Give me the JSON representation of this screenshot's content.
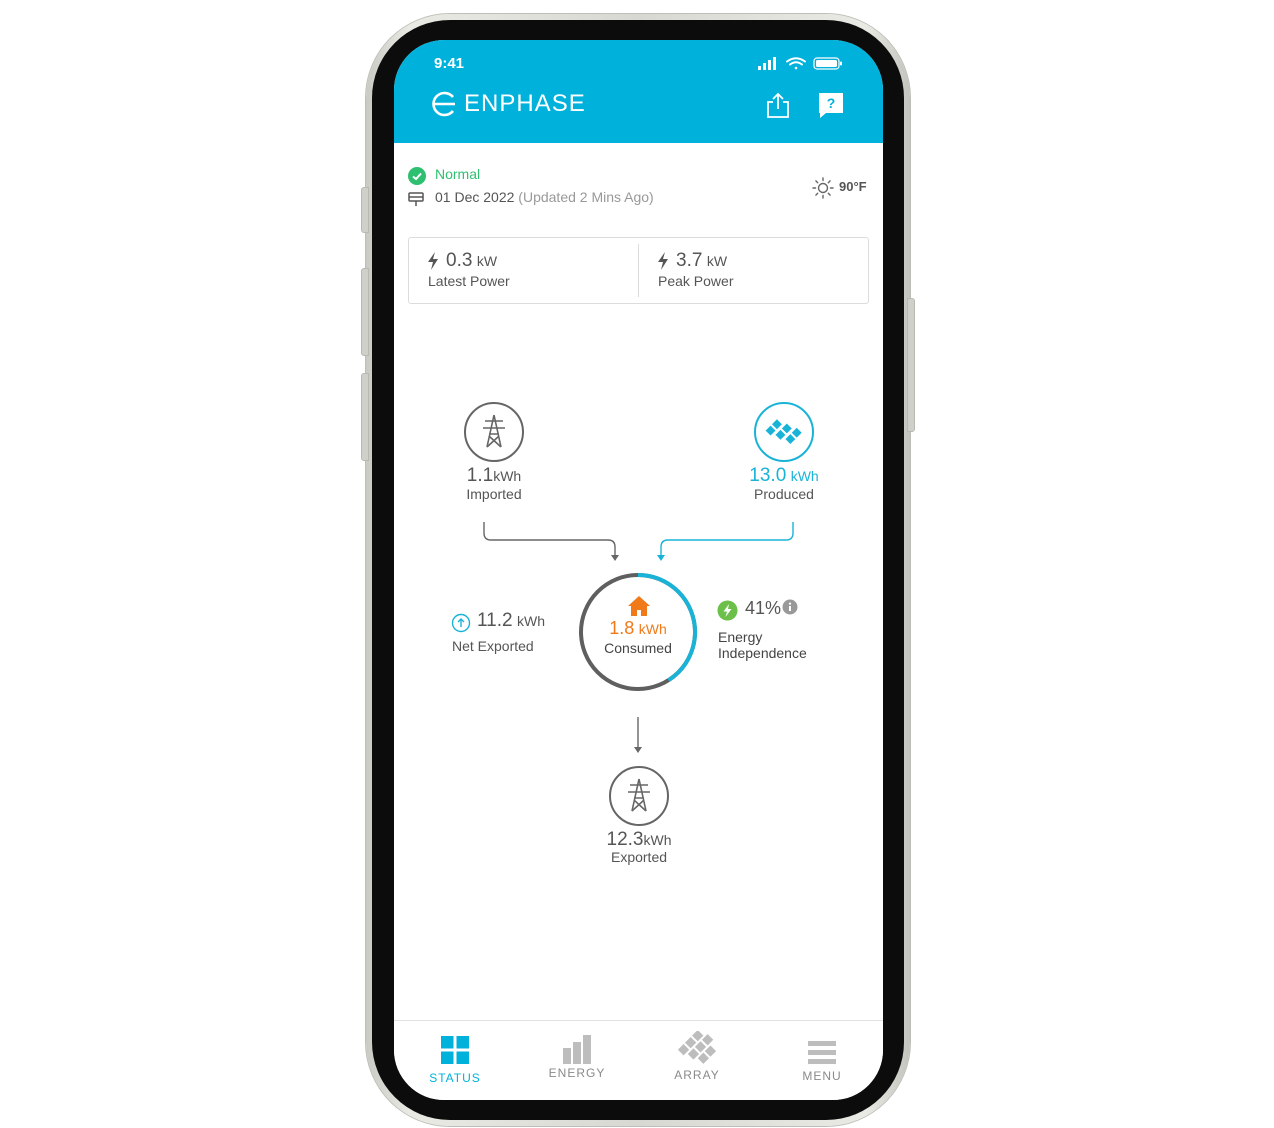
{
  "status_bar": {
    "time": "9:41"
  },
  "header": {
    "brand": "ENPHASE",
    "icons": [
      "share-icon",
      "help-icon"
    ]
  },
  "system": {
    "status": "Normal",
    "date": "01 Dec 2022",
    "updated": "(Updated 2 Mins Ago)",
    "temperature": "90°F"
  },
  "power": {
    "latest": {
      "value": "0.3",
      "unit": "kW",
      "label": "Latest Power"
    },
    "peak": {
      "value": "3.7",
      "unit": "kW",
      "label": "Peak Power"
    }
  },
  "flow": {
    "imported": {
      "value": "1.1",
      "unit": "kWh",
      "label": "Imported"
    },
    "produced": {
      "value": "13.0",
      "unit": "kWh",
      "label": "Produced"
    },
    "consumed": {
      "value": "1.8",
      "unit": "kWh",
      "label": "Consumed"
    },
    "net_exported": {
      "value": "11.2",
      "unit": "kWh",
      "label": "Net Exported"
    },
    "independence": {
      "value": "41%",
      "label_line1": "Energy",
      "label_line2": "Independence",
      "fraction": 0.41
    },
    "exported": {
      "value": "12.3",
      "unit": "kWh",
      "label": "Exported"
    }
  },
  "tabs": [
    {
      "label": "STATUS",
      "active": true
    },
    {
      "label": "ENERGY",
      "active": false
    },
    {
      "label": "ARRAY",
      "active": false
    },
    {
      "label": "MENU",
      "active": false
    }
  ],
  "colors": {
    "brand": "#00b2db",
    "ok": "#2fbf71",
    "consumed": "#f07a1a",
    "independence": "#6cc04a",
    "ring_gray": "#5f5f5f"
  }
}
